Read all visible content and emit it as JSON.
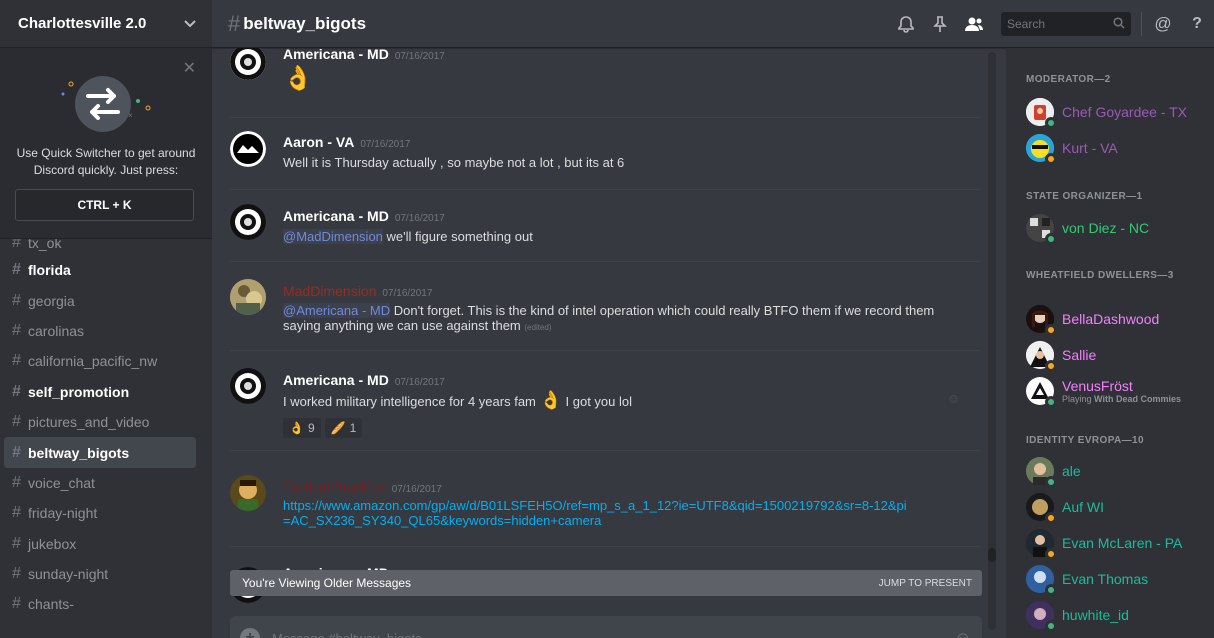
{
  "server": {
    "name": "Charlottesville 2.0"
  },
  "quick_switcher": {
    "text": "Use Quick Switcher to get around Discord quickly. Just press:",
    "shortcut": "CTRL + K"
  },
  "channels": [
    {
      "name": "tx_ok",
      "state": "normal"
    },
    {
      "name": "florida",
      "state": "unread"
    },
    {
      "name": "georgia",
      "state": "normal"
    },
    {
      "name": "carolinas",
      "state": "normal"
    },
    {
      "name": "california_pacific_nw",
      "state": "normal"
    },
    {
      "name": "self_promotion",
      "state": "unread"
    },
    {
      "name": "pictures_and_video",
      "state": "normal"
    },
    {
      "name": "beltway_bigots",
      "state": "active"
    },
    {
      "name": "voice_chat",
      "state": "normal"
    },
    {
      "name": "friday-night",
      "state": "normal"
    },
    {
      "name": "jukebox",
      "state": "normal"
    },
    {
      "name": "sunday-night",
      "state": "normal"
    },
    {
      "name": "chants-",
      "state": "normal"
    }
  ],
  "header": {
    "channel": "beltway_bigots",
    "search_placeholder": "Search"
  },
  "messages": [
    {
      "author": "Americana - MD",
      "timestamp": "07/16/2017",
      "emoji": "👌"
    },
    {
      "author": "Aaron - VA",
      "timestamp": "07/16/2017",
      "text": "Well it is Thursday actually , so maybe not a lot , but its at 6"
    },
    {
      "author": "Americana - MD",
      "timestamp": "07/16/2017",
      "mention": "@MadDimension",
      "text": " we'll figure something out"
    },
    {
      "author": "MadDimension",
      "timestamp": "07/16/2017",
      "mention": "@Americana - MD",
      "text": " Don't forget. This is the kind of intel operation which could really BTFO them if we record them saying anything we can use against them",
      "edited": "(edited)"
    },
    {
      "author": "Americana - MD",
      "timestamp": "07/16/2017",
      "text_before": "I worked military intelligence for 4 years fam ",
      "emoji": "👌",
      "text_after": " I got you lol",
      "reactions": [
        {
          "emoji": "👌",
          "count": "9"
        },
        {
          "emoji": "🥖",
          "count": "1"
        }
      ]
    },
    {
      "author": "Tactical BowlCut",
      "timestamp": "07/16/2017",
      "link": "https://www.amazon.com/gp/aw/d/B01LSFEH5O/ref=mp_s_a_1_12?ie=UTF8&qid=1500219792&sr=8-12&pi=AC_SX236_SY340_QL65&keywords=hidden+camera"
    },
    {
      "author": "Americana - MD"
    }
  ],
  "older_bar": {
    "text": "You're Viewing Older Messages",
    "jump": "JUMP TO PRESENT"
  },
  "composer": {
    "placeholder": "Message #beltway_bigots"
  },
  "members": {
    "groups": [
      {
        "title": "MODERATOR—2"
      },
      {
        "title": "STATE ORGANIZER—1"
      },
      {
        "title": "WHEATFIELD DWELLERS—3"
      },
      {
        "title": "IDENTITY EVROPA—10"
      }
    ],
    "list": [
      {
        "name": "Chef Goyardee - TX",
        "color": "#9b59b6",
        "status": "online"
      },
      {
        "name": "Kurt - VA",
        "color": "#9b59b6",
        "status": "idle"
      },
      {
        "name": "von Diez - NC",
        "color": "#2ecc71",
        "status": "online"
      },
      {
        "name": "BellaDashwood",
        "color": "#f47fff",
        "status": "idle"
      },
      {
        "name": "Sallie",
        "color": "#f47fff",
        "status": "idle"
      },
      {
        "name": "VenusFröst",
        "color": "#f47fff",
        "status": "online",
        "activity_prefix": "Playing ",
        "activity_game": "With Dead Commies"
      },
      {
        "name": "ale",
        "color": "#1abc9c",
        "status": "online"
      },
      {
        "name": "Auf WI",
        "color": "#1abc9c",
        "status": "idle"
      },
      {
        "name": "Evan McLaren - PA",
        "color": "#1abc9c",
        "status": "idle"
      },
      {
        "name": "Evan Thomas",
        "color": "#1abc9c",
        "status": "online"
      },
      {
        "name": "huwhite_id",
        "color": "#1abc9c",
        "status": "online"
      }
    ]
  }
}
